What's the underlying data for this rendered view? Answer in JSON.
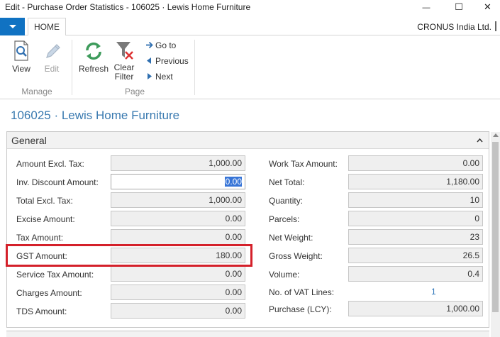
{
  "window": {
    "title": "Edit - Purchase Order Statistics - 106025 · Lewis Home Furniture",
    "minimize_glyph": "—",
    "maximize_glyph": "☐",
    "close_glyph": "✕"
  },
  "ribbon": {
    "tab_home": "HOME",
    "company": "CRONUS India Ltd.",
    "buttons": {
      "view": "View",
      "edit": "Edit",
      "refresh": "Refresh",
      "clear_filter": "Clear Filter",
      "go_to": "Go to",
      "previous": "Previous",
      "next": "Next"
    },
    "groups": {
      "manage": "Manage",
      "page": "Page"
    }
  },
  "page": {
    "title": "106025 · Lewis Home Furniture"
  },
  "general": {
    "caption": "General",
    "left_fields": [
      {
        "label": "Amount Excl. Tax:",
        "value": "1,000.00"
      },
      {
        "label": "Inv. Discount Amount:",
        "value": "0.00"
      },
      {
        "label": "Total Excl. Tax:",
        "value": "1,000.00"
      },
      {
        "label": "Excise Amount:",
        "value": "0.00"
      },
      {
        "label": "Tax Amount:",
        "value": "0.00"
      },
      {
        "label": "GST Amount:",
        "value": "180.00"
      },
      {
        "label": "Service Tax Amount:",
        "value": "0.00"
      },
      {
        "label": "Charges Amount:",
        "value": "0.00"
      },
      {
        "label": "TDS Amount:",
        "value": "0.00"
      }
    ],
    "right_fields": [
      {
        "label": "Work Tax Amount:",
        "value": "0.00"
      },
      {
        "label": "Net Total:",
        "value": "1,180.00"
      },
      {
        "label": "Quantity:",
        "value": "10"
      },
      {
        "label": "Parcels:",
        "value": "0"
      },
      {
        "label": "Net Weight:",
        "value": "23"
      },
      {
        "label": "Gross Weight:",
        "value": "26.5"
      },
      {
        "label": "Volume:",
        "value": "0.4"
      },
      {
        "label": "No. of VAT Lines:",
        "value": "1"
      },
      {
        "label": "Purchase (LCY):",
        "value": "1,000.00"
      }
    ]
  },
  "colors": {
    "accent": "#1072c2",
    "title_blue": "#3a7ab0",
    "highlight_red": "#d4202a"
  }
}
